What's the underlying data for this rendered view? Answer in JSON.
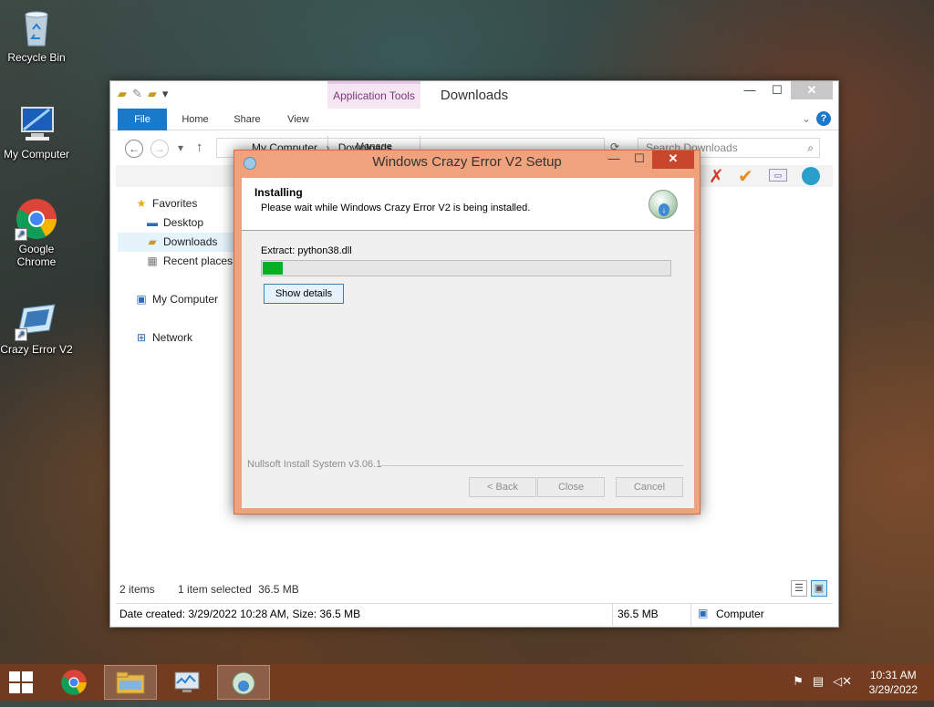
{
  "desktop": {
    "icons": [
      {
        "label": "Recycle Bin",
        "icon": "recycle-bin-icon"
      },
      {
        "label": "My Computer",
        "icon": "computer-icon"
      },
      {
        "label": "Google Chrome",
        "icon": "chrome-icon"
      },
      {
        "label": "Crazy Error V2",
        "icon": "app-icon"
      }
    ]
  },
  "explorer": {
    "title": "Downloads",
    "contextual_tab": "Application Tools",
    "tabs": {
      "file": "File",
      "home": "Home",
      "share": "Share",
      "view": "View",
      "manage": "Manage"
    },
    "address": {
      "segments": [
        "My Computer",
        "Downloads"
      ]
    },
    "search": {
      "placeholder": "Search Downloads"
    },
    "nav": {
      "favorites": "Favorites",
      "desktop": "Desktop",
      "downloads": "Downloads",
      "recent": "Recent places",
      "my_computer": "My Computer",
      "network": "Network"
    },
    "status": {
      "items": "2 items",
      "selected": "1 item selected",
      "size": "36.5 MB"
    },
    "details": {
      "created": "Date created: 3/29/2022 10:28 AM, Size: 36.5 MB",
      "size": "36.5 MB",
      "location": "Computer"
    }
  },
  "setup": {
    "title": "Windows Crazy Error V2 Setup",
    "header": "Installing",
    "subheader": "Please wait while Windows Crazy Error V2 is being installed.",
    "extract_text": "Extract: python38.dll",
    "progress": 0.05,
    "show_details": "Show details",
    "branding": "Nullsoft Install System v3.06.1",
    "back": "< Back",
    "close": "Close",
    "cancel": "Cancel"
  },
  "taskbar": {
    "clock_time": "10:31 AM",
    "clock_date": "3/29/2022",
    "progress_color": "#06b025",
    "accent": "#1979ca"
  }
}
